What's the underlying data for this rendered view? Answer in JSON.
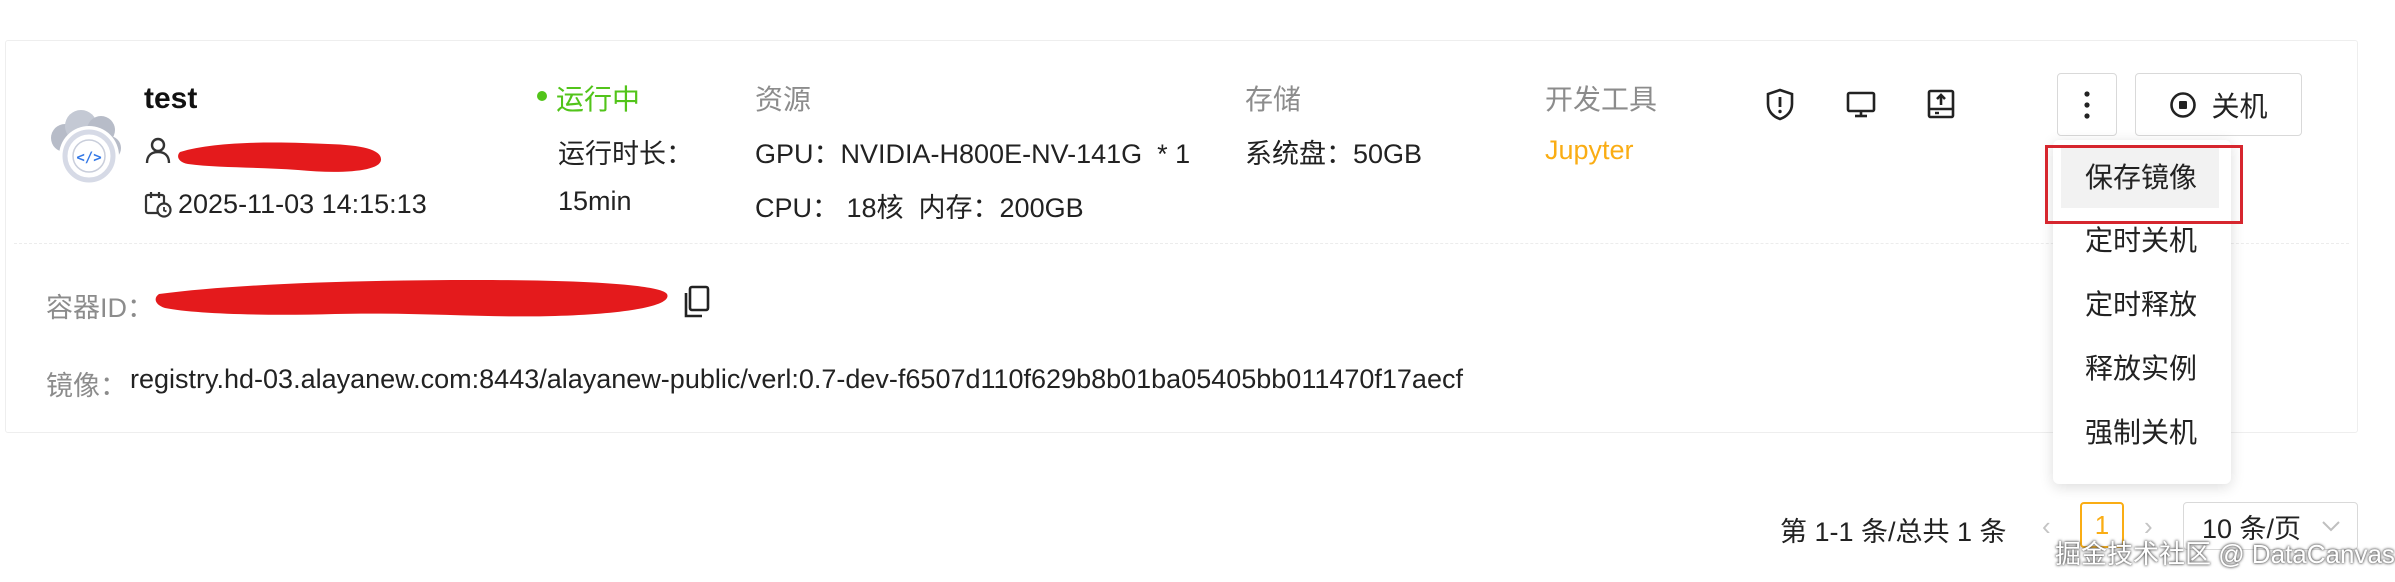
{
  "instance": {
    "name": "test",
    "created_time": "2025-11-03 14:15:13",
    "status": "运行中",
    "runtime_label": "运行时长：",
    "runtime_value": "15min",
    "resources_label": "资源",
    "gpu": "GPU：NVIDIA-H800E-NV-141G  * 1",
    "cpu_mem": "CPU： 18核  内存：200GB",
    "storage_label": "存储",
    "system_disk": "系统盘：50GB",
    "dev_tools_label": "开发工具",
    "dev_tool": "Jupyter",
    "container_id_label": "容器ID：",
    "image_label": "镜像：",
    "image_value": "registry.hd-03.alayanew.com:8443/alayanew-public/verl:0.7-dev-f6507d110f629b8b01ba05405bb011470f17aecf"
  },
  "actions": {
    "power_off_label": "关机"
  },
  "more_menu": {
    "items": [
      {
        "label": "保存镜像",
        "highlighted": true
      },
      {
        "label": "定时关机"
      },
      {
        "label": "定时释放"
      },
      {
        "label": "释放实例"
      },
      {
        "label": "强制关机"
      }
    ]
  },
  "pagination": {
    "summary": "第 1-1 条/总共 1 条",
    "current_page": "1",
    "page_size": "10 条/页",
    "prev_icon": "chevron-left-icon",
    "next_icon": "chevron-right-icon"
  },
  "watermark": "掘金技术社区 @ DataCanvas",
  "colors": {
    "running": "#52c41a",
    "accent": "#faad14",
    "highlight_outline": "#d6262e",
    "redaction": "#e41a1c"
  }
}
